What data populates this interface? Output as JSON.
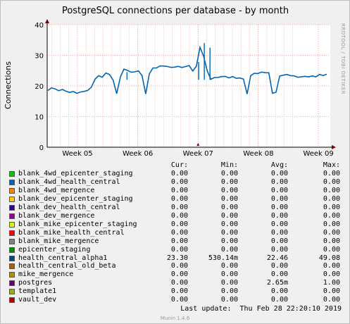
{
  "chart_data": {
    "type": "line",
    "title": "PostgreSQL connections per database - by month",
    "ylabel": "Connections",
    "xlabel": "",
    "ylim": [
      0,
      40
    ],
    "yticks": [
      "0",
      "10",
      "20",
      "30",
      "40"
    ],
    "xticks": [
      "Week 05",
      "Week 06",
      "Week 07",
      "Week 08",
      "Week 09"
    ],
    "grid": true,
    "side_text": "RRDTOOL / TOBI OETIKER",
    "series": [
      {
        "name": "health_central_alpha1",
        "color": "#0066b3",
        "values": [
          18.5,
          19.2,
          18.7,
          18.0,
          18.4,
          17.9,
          17.6,
          18.1,
          17.7,
          18.3,
          18.6,
          19.0,
          20.0,
          22.5,
          23.5,
          22.8,
          24.0,
          23.4,
          21.5,
          17.0,
          22.5,
          25.3,
          25.0,
          24.6,
          24.9,
          25.3,
          23.8,
          17.8,
          24.2,
          26.0,
          25.8,
          26.3,
          26.1,
          25.9,
          25.6,
          25.8,
          26.2,
          26.0,
          26.5,
          27.0,
          25.3,
          26.9,
          33.0,
          30.0,
          25.0,
          22.1,
          22.5,
          22.4,
          22.6,
          22.7,
          22.3,
          22.9,
          22.5,
          22.8,
          22.6,
          17.8,
          23.8,
          24.5,
          24.3,
          24.6,
          24.2,
          24.0,
          17.2,
          17.5,
          22.8,
          23.2,
          23.6,
          23.4,
          23.5,
          23.2,
          23.4,
          23.6,
          23.3,
          23.5,
          23.0,
          23.6,
          23.1,
          23.4
        ],
        "spikes": [
          {
            "x": 0.282,
            "y": 24.5
          },
          {
            "x": 0.535,
            "y": 27.8
          },
          {
            "x": 0.555,
            "y": 34.0
          },
          {
            "x": 0.575,
            "y": 32.5
          }
        ]
      }
    ]
  },
  "legend": {
    "headers": {
      "cur": "Cur:",
      "min": "Min:",
      "avg": "Avg:",
      "max": "Max:"
    },
    "items": [
      {
        "name": "blank_4wd_epicenter_staging",
        "color": "#00cc00",
        "cur": "0.00",
        "min": "0.00",
        "avg": "0.00",
        "max": "0.00"
      },
      {
        "name": "blank_4wd_health_central",
        "color": "#0066b3",
        "cur": "0.00",
        "min": "0.00",
        "avg": "0.00",
        "max": "0.00"
      },
      {
        "name": "blank_4wd_mergence",
        "color": "#ff8000",
        "cur": "0.00",
        "min": "0.00",
        "avg": "0.00",
        "max": "0.00"
      },
      {
        "name": "blank_dev_epicenter_staging",
        "color": "#ffcc00",
        "cur": "0.00",
        "min": "0.00",
        "avg": "0.00",
        "max": "0.00"
      },
      {
        "name": "blank_dev_health_central",
        "color": "#330099",
        "cur": "0.00",
        "min": "0.00",
        "avg": "0.00",
        "max": "0.00"
      },
      {
        "name": "blank_dev_mergence",
        "color": "#990099",
        "cur": "0.00",
        "min": "0.00",
        "avg": "0.00",
        "max": "0.00"
      },
      {
        "name": "blank_mike_epicenter_staging",
        "color": "#ccff00",
        "cur": "0.00",
        "min": "0.00",
        "avg": "0.00",
        "max": "0.00"
      },
      {
        "name": "blank_mike_health_central",
        "color": "#ff0000",
        "cur": "0.00",
        "min": "0.00",
        "avg": "0.00",
        "max": "0.00"
      },
      {
        "name": "blank_mike_mergence",
        "color": "#808080",
        "cur": "0.00",
        "min": "0.00",
        "avg": "0.00",
        "max": "0.00"
      },
      {
        "name": "epicenter_staging",
        "color": "#008f00",
        "cur": "0.00",
        "min": "0.00",
        "avg": "0.00",
        "max": "0.00"
      },
      {
        "name": "health_central_alpha1",
        "color": "#00487d",
        "cur": "23.30",
        "min": "530.14m",
        "avg": "22.46",
        "max": "49.08"
      },
      {
        "name": "health_central_old_beta",
        "color": "#b35a00",
        "cur": "0.00",
        "min": "0.00",
        "avg": "0.00",
        "max": "0.00"
      },
      {
        "name": "mike_mergence",
        "color": "#b38f00",
        "cur": "0.00",
        "min": "0.00",
        "avg": "0.00",
        "max": "0.00"
      },
      {
        "name": "postgres",
        "color": "#6b006b",
        "cur": "0.00",
        "min": "0.00",
        "avg": "2.65m",
        "max": "1.00"
      },
      {
        "name": "template1",
        "color": "#8fb300",
        "cur": "0.00",
        "min": "0.00",
        "avg": "0.00",
        "max": "0.00"
      },
      {
        "name": "vault_dev",
        "color": "#b30000",
        "cur": "0.00",
        "min": "0.00",
        "avg": "0.00",
        "max": "0.00"
      }
    ]
  },
  "footer": {
    "last_update": "Last update:  Thu Feb 28 22:20:10 2019",
    "munin": "Munin 1.4.6"
  }
}
